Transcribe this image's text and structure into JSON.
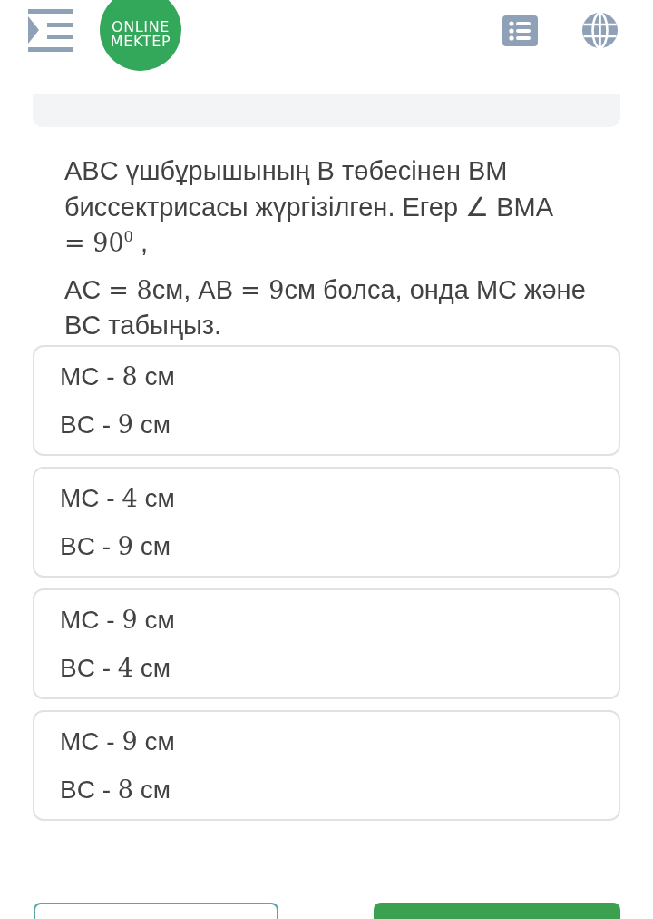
{
  "header": {
    "logo": {
      "lines": [
        "ONLINE",
        "MEKTEP"
      ]
    }
  },
  "question": {
    "paragraphs": [
      [
        {
          "kind": "text",
          "text": "ABC үшбұрышының B төбесінен BM биссектрисасы жүргізілген. Егер ∠ BMA "
        },
        {
          "kind": "math",
          "text": "= 90$^{0}$"
        },
        {
          "kind": "text",
          "text": " ,"
        }
      ],
      [
        {
          "kind": "text",
          "text": "AC "
        },
        {
          "kind": "math",
          "text": "= 8"
        },
        {
          "kind": "text",
          "text": "см, AB "
        },
        {
          "kind": "math",
          "text": "= 9"
        },
        {
          "kind": "text",
          "text": "см болса, онда MC және BC табыңыз."
        }
      ]
    ]
  },
  "options": [
    {
      "selected": false,
      "lines": [
        [
          {
            "kind": "text",
            "text": "MC - "
          },
          {
            "kind": "math",
            "text": "8"
          },
          {
            "kind": "text",
            "text": " см"
          }
        ],
        [
          {
            "kind": "text",
            "text": "BC - "
          },
          {
            "kind": "math",
            "text": "9"
          },
          {
            "kind": "text",
            "text": " см"
          }
        ]
      ]
    },
    {
      "selected": false,
      "lines": [
        [
          {
            "kind": "text",
            "text": "MC - "
          },
          {
            "kind": "math",
            "text": "4"
          },
          {
            "kind": "text",
            "text": " см"
          }
        ],
        [
          {
            "kind": "text",
            "text": "BC - "
          },
          {
            "kind": "math",
            "text": "9"
          },
          {
            "kind": "text",
            "text": " см"
          }
        ]
      ]
    },
    {
      "selected": false,
      "lines": [
        [
          {
            "kind": "text",
            "text": "MC - "
          },
          {
            "kind": "math",
            "text": "9"
          },
          {
            "kind": "text",
            "text": " см"
          }
        ],
        [
          {
            "kind": "text",
            "text": "BC - "
          },
          {
            "kind": "math",
            "text": "4"
          },
          {
            "kind": "text",
            "text": " см"
          }
        ]
      ]
    },
    {
      "selected": false,
      "lines": [
        [
          {
            "kind": "text",
            "text": "MC - "
          },
          {
            "kind": "math",
            "text": "9"
          },
          {
            "kind": "text",
            "text": " см"
          }
        ],
        [
          {
            "kind": "text",
            "text": "BC - "
          },
          {
            "kind": "math",
            "text": "8"
          },
          {
            "kind": "text",
            "text": " см"
          }
        ]
      ]
    }
  ],
  "footer": {
    "buttons": [
      {
        "kind": "outline"
      },
      {
        "kind": "filled"
      }
    ]
  }
}
